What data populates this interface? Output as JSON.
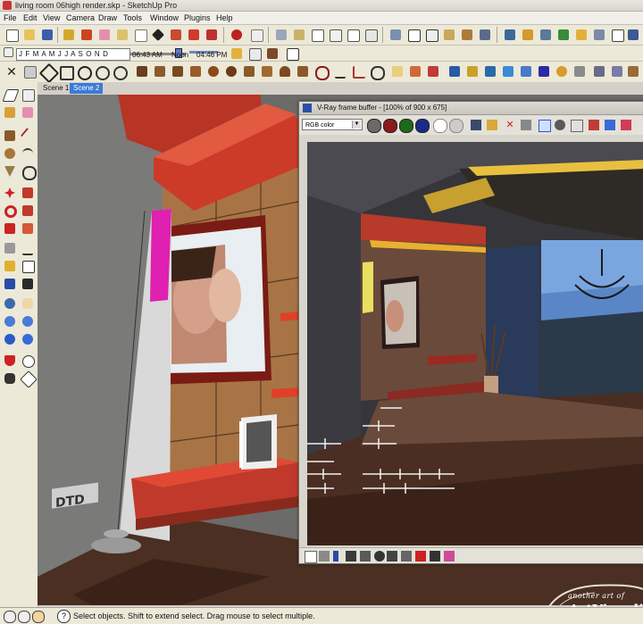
{
  "window": {
    "title": "living room 06high render.skp - SketchUp Pro"
  },
  "menu": [
    "File",
    "Edit",
    "View",
    "Camera",
    "Draw",
    "Tools",
    "Window",
    "Plugins",
    "Help"
  ],
  "shadow_bar": {
    "months": "J F M A M J J A S O N D",
    "time_start": "06:43 AM",
    "noon": "Noon",
    "time_end": "04:46 PM"
  },
  "scenes": [
    {
      "label": "Scene 1",
      "active": false
    },
    {
      "label": "Scene 2",
      "active": true
    }
  ],
  "vray": {
    "title": "V-Ray frame buffer - [100% of 900 x 675]",
    "channel": "RGB color",
    "colors": {
      "red": "#8b1a1a",
      "green": "#1c6a1c",
      "blue": "#1a2a8a"
    }
  },
  "status": {
    "message": "Select objects. Shift to extend select. Drag mouse to select multiple."
  },
  "watermark": {
    "small": "another art of",
    "big": "ArtVisualizer"
  },
  "colors": {
    "viewport_bg": "#6c6c6a",
    "active_tab": "#3b7bd6",
    "wall_red": "#c0392b"
  }
}
